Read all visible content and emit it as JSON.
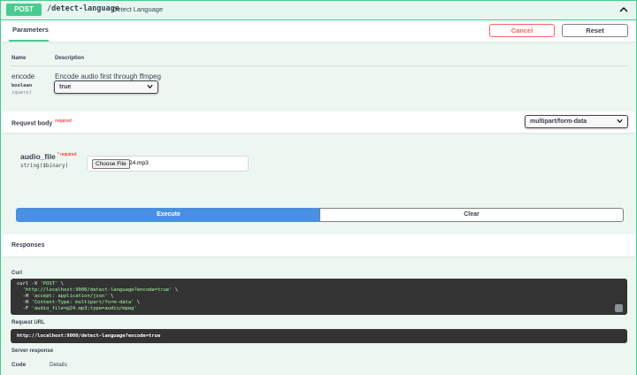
{
  "summary": {
    "method": "POST",
    "path": "/detect-language",
    "description": "Detect Language"
  },
  "parameters": {
    "tab_label": "Parameters",
    "cancel_label": "Cancel",
    "reset_label": "Reset",
    "col_name": "Name",
    "col_description": "Description",
    "items": [
      {
        "name": "encode",
        "type": "boolean",
        "in": "(query)",
        "description": "Encode audio first through ffmpeg",
        "value": "true"
      }
    ]
  },
  "request_body": {
    "title": "Request body",
    "required_label": "required",
    "content_type": "multipart/form-data",
    "field_name": "audio_file",
    "field_required": "* required",
    "field_type": "string($binary)",
    "choose_label": "Choose File",
    "file_name": "24.mp3"
  },
  "actions": {
    "execute_label": "Execute",
    "clear_label": "Clear"
  },
  "responses": {
    "title": "Responses",
    "curl_label": "Curl",
    "curl_lines": [
      {
        "pre": "curl -X ",
        "str": "'POST'",
        "post": " \\"
      },
      {
        "pre": "  ",
        "str": "'http://localhost:9000/detect-language?encode=true'",
        "post": " \\"
      },
      {
        "pre": "  -H ",
        "str": "'accept: application/json'",
        "post": " \\"
      },
      {
        "pre": "  -H ",
        "str": "'Content-Type: multipart/form-data'",
        "post": " \\"
      },
      {
        "pre": "  -F ",
        "str": "'audio_file=@24.mp3;type=audio/mpeg'",
        "post": ""
      }
    ],
    "request_url_label": "Request URL",
    "request_url": "http://localhost:9000/detect-language?encode=true",
    "server_response_label": "Server response",
    "col_code": "Code",
    "col_details": "Details"
  },
  "colors": {
    "post_green": "#49cc90",
    "execute_blue": "#4990e2",
    "cancel_red": "#ff6060"
  }
}
